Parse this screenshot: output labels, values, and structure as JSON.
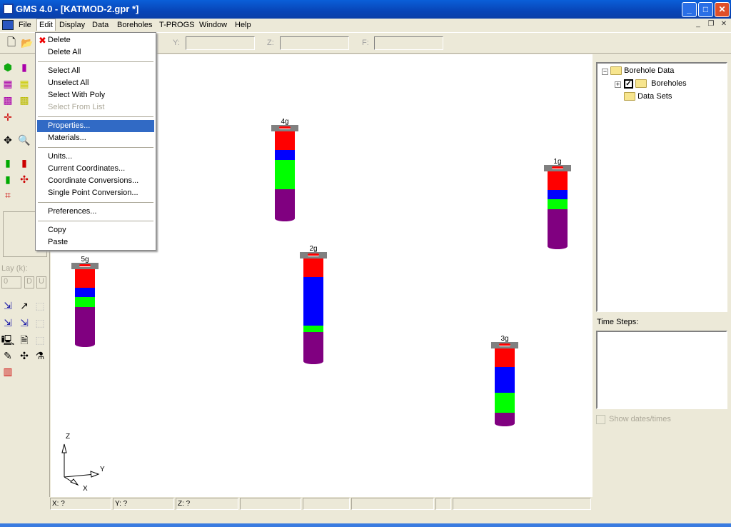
{
  "window": {
    "title": "GMS 4.0 - [KATMOD-2.gpr *]",
    "minimize": "_",
    "maximize": "□",
    "close": "✕"
  },
  "menubar": {
    "items": [
      "File",
      "Edit",
      "Display",
      "Data",
      "Boreholes",
      "T-PROGS",
      "Window",
      "Help"
    ],
    "mdi_minimize": "_",
    "mdi_restore": "❐",
    "mdi_close": "✕"
  },
  "toolbar": {
    "y_label": "Y:",
    "z_label": "Z:",
    "f_label": "F:",
    "y_value": "",
    "z_value": "",
    "f_value": ""
  },
  "edit_menu": {
    "items": [
      {
        "label": "Delete",
        "icon": "red-x-icon"
      },
      {
        "label": "Delete All"
      },
      {
        "label": "Select All"
      },
      {
        "label": "Unselect All"
      },
      {
        "label": "Select With Poly"
      },
      {
        "label": "Select From List",
        "disabled": true
      },
      {
        "label": "Properties...",
        "highlighted": true
      },
      {
        "label": "Materials..."
      },
      {
        "label": "Units..."
      },
      {
        "label": "Current Coordinates..."
      },
      {
        "label": "Coordinate Conversions..."
      },
      {
        "label": "Single Point Conversion..."
      },
      {
        "label": "Preferences..."
      },
      {
        "label": "Copy"
      },
      {
        "label": "Paste"
      }
    ]
  },
  "left_panel": {
    "lay_label": "Lay (k):",
    "lay_value": "0",
    "down_button": "D",
    "up_button": "U"
  },
  "boreholes": [
    {
      "name": "4g"
    },
    {
      "name": "1g"
    },
    {
      "name": "5g"
    },
    {
      "name": "2g"
    },
    {
      "name": "3g"
    }
  ],
  "layer_colors": {
    "red": "#ff0000",
    "blue": "#0000ff",
    "green": "#00ff00",
    "purple": "#800080"
  },
  "axes": {
    "z": "Z",
    "y": "Y",
    "x": "X"
  },
  "tree": {
    "root": "Borehole Data",
    "children": [
      "Boreholes",
      "Data Sets"
    ],
    "boreholes_checked": true
  },
  "time_steps": {
    "label": "Time Steps:",
    "show_dates": "Show dates/times"
  },
  "statusbar": {
    "x": "X: ?",
    "y": "Y: ?",
    "z": "Z: ?"
  }
}
